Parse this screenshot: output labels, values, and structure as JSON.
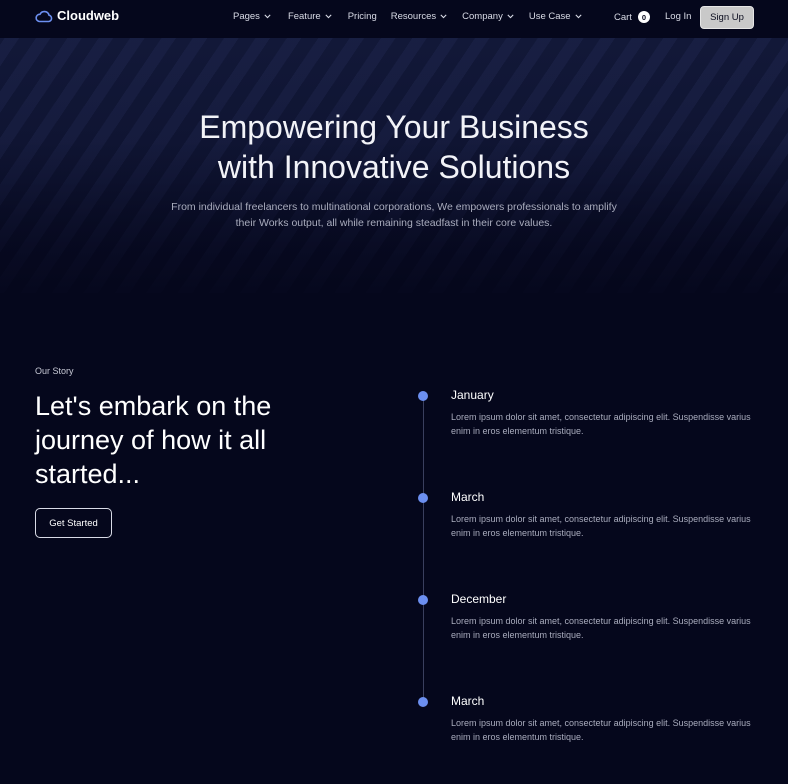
{
  "nav": {
    "brand": "Cloudweb",
    "items": [
      {
        "label": "Pages",
        "has_dropdown": true
      },
      {
        "label": "Feature",
        "has_dropdown": true
      },
      {
        "label": "Pricing",
        "has_dropdown": false
      },
      {
        "label": "Resources",
        "has_dropdown": true
      },
      {
        "label": "Company",
        "has_dropdown": true
      },
      {
        "label": "Use Case",
        "has_dropdown": true
      }
    ],
    "cart_label": "Cart",
    "cart_count": "0",
    "login_label": "Log In",
    "signup_label": "Sign Up"
  },
  "hero": {
    "title_line1": "Empowering Your Business",
    "title_line2": "with Innovative Solutions",
    "subtitle": "From individual freelancers to multinational corporations, We empowers professionals to amplify their Works output, all while remaining steadfast in their core values."
  },
  "story": {
    "eyebrow": "Our Story",
    "heading": "Let's embark on the journey of how it all started...",
    "cta_label": "Get Started"
  },
  "timeline": [
    {
      "title": "January",
      "desc": "Lorem ipsum dolor sit amet, consectetur adipiscing elit. Suspendisse varius enim in eros elementum tristique."
    },
    {
      "title": "March",
      "desc": "Lorem ipsum dolor sit amet, consectetur adipiscing elit. Suspendisse varius enim in eros elementum tristique."
    },
    {
      "title": "December",
      "desc": "Lorem ipsum dolor sit amet, consectetur adipiscing elit. Suspendisse varius enim in eros elementum tristique."
    },
    {
      "title": "March",
      "desc": "Lorem ipsum dolor sit amet, consectetur adipiscing elit. Suspendisse varius enim in eros elementum tristique."
    }
  ],
  "icons": {
    "logo": "cloud-icon",
    "dropdown": "chevron-down-icon",
    "timeline_marker": "dot-icon"
  },
  "colors": {
    "background": "#05071c",
    "accent": "#6c8ff0",
    "signup_button": "#c9c9c9"
  }
}
